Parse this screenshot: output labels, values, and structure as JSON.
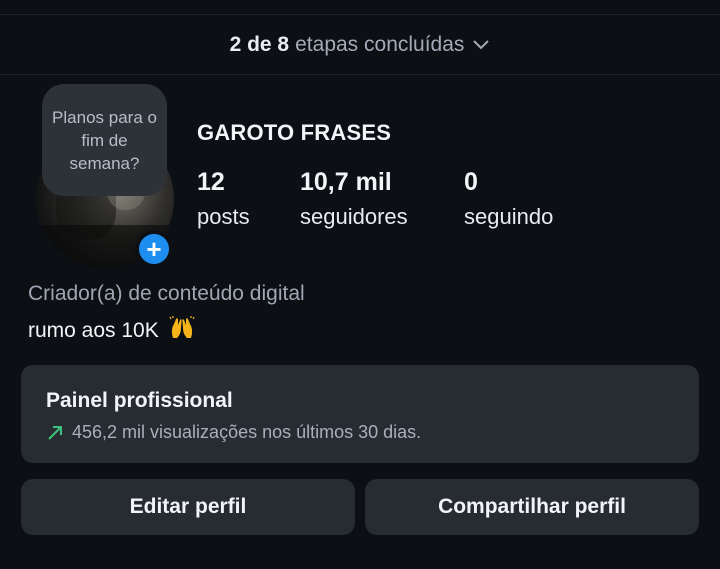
{
  "steps": {
    "count": "2 de 8",
    "label": "etapas concluídas"
  },
  "profile": {
    "note": "Planos para o fim de semana?",
    "name": "GAROTO FRASES",
    "stats": [
      {
        "value": "12",
        "label": "posts"
      },
      {
        "value": "10,7 mil",
        "label": "seguidores"
      },
      {
        "value": "0",
        "label": "seguindo"
      }
    ],
    "category": "Criador(a) de conteúdo digital",
    "bio": "rumo aos 10K"
  },
  "panel": {
    "title": "Painel profissional",
    "stats": "456,2 mil visualizações nos últimos 30 dias."
  },
  "buttons": {
    "edit": "Editar perfil",
    "share": "Compartilhar perfil"
  },
  "colors": {
    "background": "#0c0f14",
    "surface": "#272b32",
    "accent_blue": "#1d8ef0",
    "trend_green": "#3ec27a"
  },
  "icons": {
    "steps_toggle": "chevron-down-icon",
    "add_story": "plus-icon",
    "bio_emoji": "raising-hands-emoji",
    "trend": "trend-up-arrow-icon"
  }
}
